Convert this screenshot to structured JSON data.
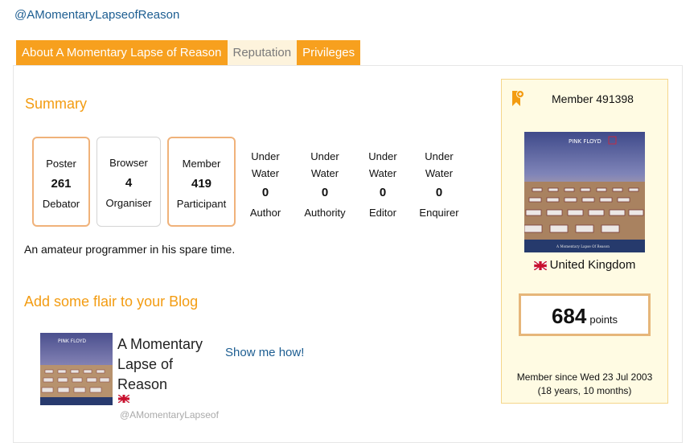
{
  "profile": {
    "handle": "@AMomentaryLapseofReason"
  },
  "tabs": [
    {
      "label": "About A Momentary Lapse of Reason"
    },
    {
      "label": "Reputation"
    },
    {
      "label": "Privileges"
    }
  ],
  "summary": {
    "title": "Summary",
    "badges": [
      {
        "label": "Poster",
        "value": "261",
        "sub": "Debator"
      },
      {
        "label": "Browser",
        "value": "4",
        "sub": "Organiser"
      },
      {
        "label": "Member",
        "value": "419",
        "sub": "Participant"
      }
    ],
    "underwater": [
      {
        "line1": "Under",
        "line2": "Water",
        "value": "0",
        "sub": "Author"
      },
      {
        "line1": "Under",
        "line2": "Water",
        "value": "0",
        "sub": "Authority"
      },
      {
        "line1": "Under",
        "line2": "Water",
        "value": "0",
        "sub": "Editor"
      },
      {
        "line1": "Under",
        "line2": "Water",
        "value": "0",
        "sub": "Enquirer"
      }
    ],
    "bio": "An amateur programmer in his spare time."
  },
  "flair": {
    "title": "Add some flair to your Blog",
    "name": "A Momentary Lapse of Reason",
    "handle": "@AMomentaryLapseof",
    "link": "Show me how!",
    "album_band": "PINK FLOYD"
  },
  "member_card": {
    "member_label": "Member 491398",
    "album_band": "PINK FLOYD",
    "album_caption": "A Momentary Lapse Of Reason",
    "country": "United Kingdom",
    "points": "684",
    "points_unit": "points",
    "since": "Member since Wed 23 Jul 2003",
    "duration": "(18 years, 10 months)"
  },
  "colors": {
    "accent": "#f7a01e",
    "link": "#1c5d91",
    "card_bg": "#fffbe3"
  },
  "icons": {
    "ribbon": "award-ribbon-icon",
    "flag": "uk-flag-icon"
  }
}
